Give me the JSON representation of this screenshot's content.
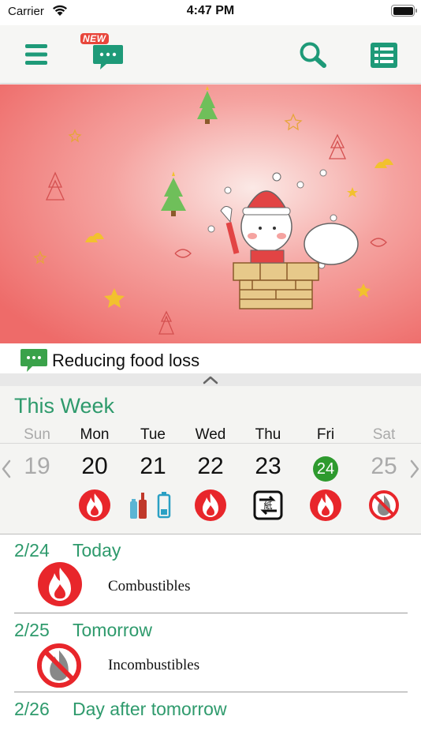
{
  "status_bar": {
    "carrier": "Carrier",
    "time": "4:47 PM"
  },
  "toolbar": {
    "menu_icon": "hamburger-menu-icon",
    "new_badge": "NEW",
    "message_icon": "chat-bubble-icon",
    "search_icon": "search-icon",
    "list_icon": "list-icon",
    "accent": "#1e9a78"
  },
  "banner": {
    "theme": "christmas-snowman-chimney"
  },
  "news": {
    "text": "Reducing food loss"
  },
  "week": {
    "title": "This Week",
    "days": [
      {
        "name": "Sun",
        "date": "19",
        "dim": true,
        "icon": "none"
      },
      {
        "name": "Mon",
        "date": "20",
        "dim": false,
        "icon": "combustibles-fire-icon"
      },
      {
        "name": "Tue",
        "date": "21",
        "dim": false,
        "icon": "bottles-battery-icon"
      },
      {
        "name": "Wed",
        "date": "22",
        "dim": false,
        "icon": "combustibles-fire-icon"
      },
      {
        "name": "Thu",
        "date": "23",
        "dim": false,
        "icon": "recycle-paper-icon"
      },
      {
        "name": "Fri",
        "date": "24",
        "dim": false,
        "icon": "combustibles-fire-icon",
        "today": true
      },
      {
        "name": "Sat",
        "date": "25",
        "dim": true,
        "icon": "incombustibles-icon"
      }
    ],
    "today_color": "#2e9a2e"
  },
  "schedule": [
    {
      "date": "2/24",
      "label": "Today",
      "item": "Combustibles",
      "icon": "combustibles-fire-icon"
    },
    {
      "date": "2/25",
      "label": "Tomorrow",
      "item": "Incombustibles",
      "icon": "incombustibles-icon"
    },
    {
      "date": "2/26",
      "label": "Day after tomorrow"
    }
  ],
  "colors": {
    "fire_red": "#e8262b",
    "green_text": "#2e9a6c"
  }
}
